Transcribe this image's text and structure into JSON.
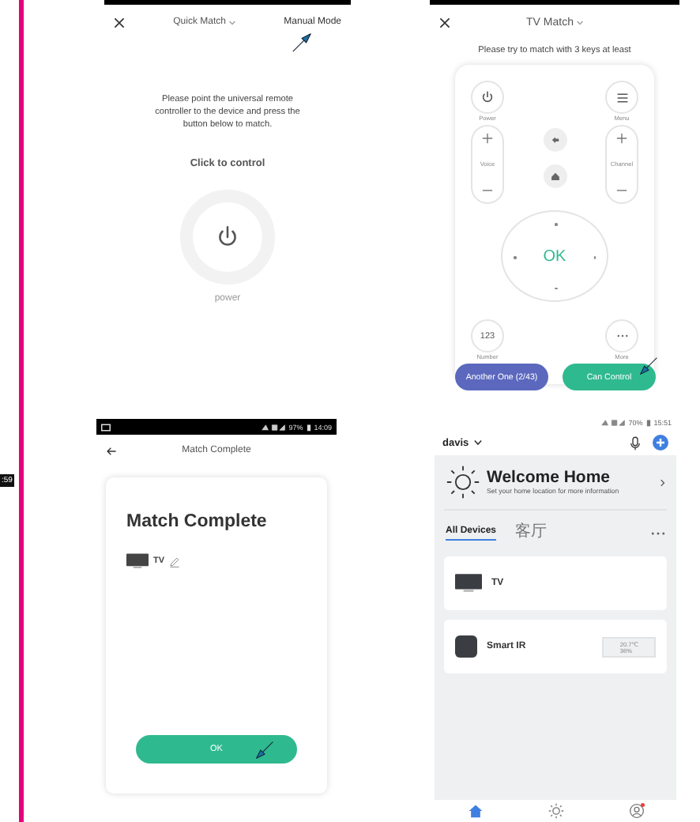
{
  "side_fragment": ":59",
  "quick_match": {
    "title": "Quick Match",
    "mode_link": "Manual Mode",
    "instruction": "Please point the universal remote controller to the device and press the button below to match.",
    "prompt": "Click to control",
    "button_label": "power"
  },
  "tv_match": {
    "title": "TV Match",
    "hint": "Please try to match with 3 keys at least",
    "power_label": "Power",
    "menu_label": "Menu",
    "volume_label": "Voice",
    "channel_label": "Channel",
    "ok_label": "OK",
    "number_key": "123",
    "number_label": "Number",
    "more_label": "More",
    "another_button": "Another One (2/43)",
    "confirm_button": "Can Control"
  },
  "match_complete": {
    "battery": "97%",
    "time": "14:09",
    "header": "Match Complete",
    "title": "Match Complete",
    "device": "TV",
    "button": "OK"
  },
  "home": {
    "battery": "70%",
    "time": "15:51",
    "user": "davis",
    "welcome_title": "Welcome Home",
    "welcome_subtitle": "Set your home location for more information",
    "tabs": [
      {
        "label": "All Devices",
        "selected": true
      },
      {
        "label": "客厅",
        "selected": false
      }
    ],
    "devices": [
      {
        "kind": "tv",
        "name": "TV"
      },
      {
        "kind": "ir",
        "name": "Smart IR",
        "readings": [
          "20.7℃",
          "36%"
        ]
      }
    ],
    "nav": [
      {
        "kind": "home",
        "selected": true,
        "badge": false
      },
      {
        "kind": "scene",
        "selected": false,
        "badge": false
      },
      {
        "kind": "profile",
        "selected": false,
        "badge": true
      }
    ]
  }
}
